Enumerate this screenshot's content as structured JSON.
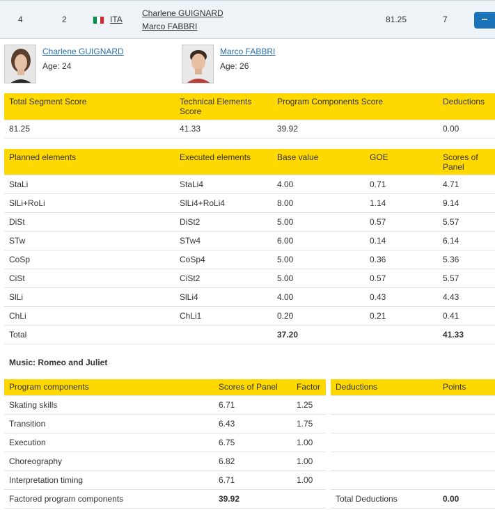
{
  "topbar": {
    "rank": "4",
    "start_no": "2",
    "nation": "ITA",
    "name1": "Charlene GUIGNARD",
    "name2": "Marco FABBRI",
    "score": "81.25",
    "place": "7",
    "collapse_symbol": "–",
    "flag_colors": [
      "#009246",
      "#ffffff",
      "#ce2b37"
    ]
  },
  "athletes": [
    {
      "name": "Charlene GUIGNARD",
      "age": "Age: 24"
    },
    {
      "name": "Marco FABBRI",
      "age": "Age: 26"
    }
  ],
  "summary": {
    "headers": [
      "Total Segment Score",
      "Technical Elements Score",
      "Program Components Score",
      "Deductions"
    ],
    "values": [
      "81.25",
      "41.33",
      "39.92",
      "0.00"
    ]
  },
  "elements": {
    "headers": [
      "Planned elements",
      "Executed elements",
      "Base value",
      "GOE",
      "Scores of Panel"
    ],
    "rows": [
      [
        "StaLi",
        "StaLi4",
        "4.00",
        "0.71",
        "4.71"
      ],
      [
        "SlLi+RoLi",
        "SlLi4+RoLi4",
        "8.00",
        "1.14",
        "9.14"
      ],
      [
        "DiSt",
        "DiSt2",
        "5.00",
        "0.57",
        "5.57"
      ],
      [
        "STw",
        "STw4",
        "6.00",
        "0.14",
        "6.14"
      ],
      [
        "CoSp",
        "CoSp4",
        "5.00",
        "0.36",
        "5.36"
      ],
      [
        "CiSt",
        "CiSt2",
        "5.00",
        "0.57",
        "5.57"
      ],
      [
        "SlLi",
        "SlLi4",
        "4.00",
        "0.43",
        "4.43"
      ],
      [
        "ChLi",
        "ChLi1",
        "0.20",
        "0.21",
        "0.41"
      ]
    ],
    "total_label": "Total",
    "total_base": "37.20",
    "total_panel": "41.33"
  },
  "music": "Music: Romeo and Juliet",
  "components": {
    "headers": [
      "Program components",
      "Scores of Panel",
      "Factor"
    ],
    "rows": [
      [
        "Skating skills",
        "6.71",
        "1.25"
      ],
      [
        "Transition",
        "6.43",
        "1.75"
      ],
      [
        "Execution",
        "6.75",
        "1.00"
      ],
      [
        "Choreography",
        "6.82",
        "1.00"
      ],
      [
        "Interpretation timing",
        "6.71",
        "1.00"
      ]
    ],
    "factored_label": "Factored program components",
    "factored_value": "39.92"
  },
  "deductions": {
    "headers": [
      "Deductions",
      "Points"
    ],
    "total_label": "Total Deductions",
    "total_value": "0.00"
  }
}
